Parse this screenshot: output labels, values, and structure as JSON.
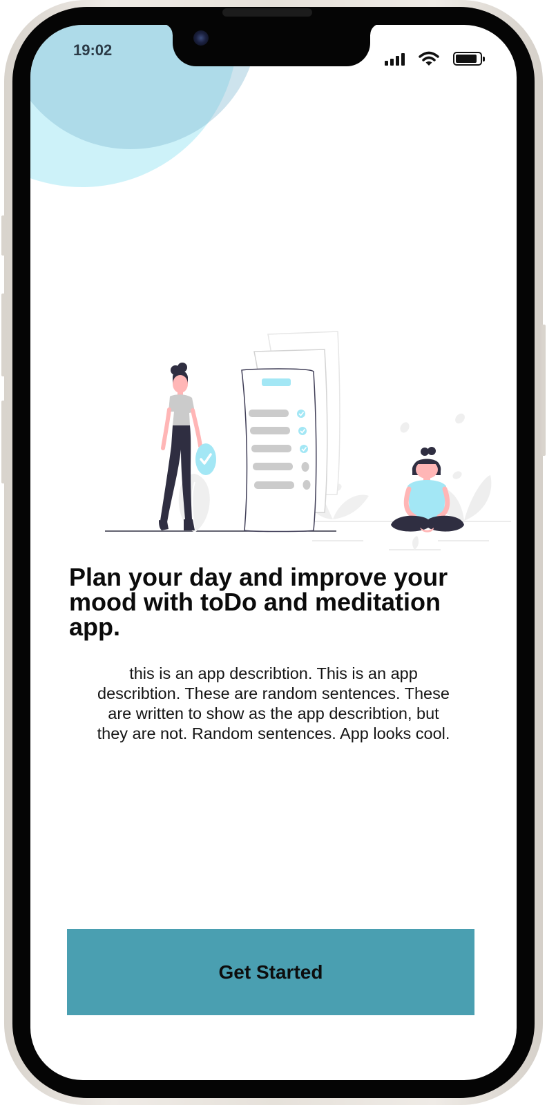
{
  "status_bar": {
    "time": "19:02"
  },
  "onboarding": {
    "headline": "Plan your day and improve your mood with toDo and meditation app.",
    "description": "this is an app describtion. This is an app describtion. These are random sentences. These are written to show as the app describtion, but they are not. Random sentences. App looks cool.",
    "cta_label": "Get Started"
  },
  "colors": {
    "accent": "#4a9fb1",
    "illustration_highlight": "#a3e7f5",
    "background_circle_light": "#c9eff8",
    "background_circle_dark": "#a9cfdf",
    "headline_text": "#0b0b0b"
  },
  "icons": [
    "signal-icon",
    "wifi-icon",
    "battery-icon",
    "checkmark-icon"
  ],
  "illustration": {
    "subject": "person-with-checklist-and-meditating-person"
  }
}
